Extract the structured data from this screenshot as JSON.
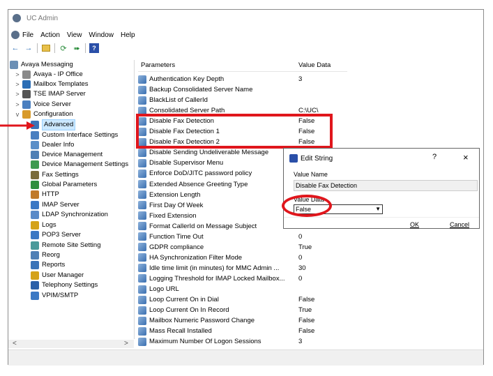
{
  "app": {
    "title": "UC Admin"
  },
  "menu": [
    "File",
    "Action",
    "View",
    "Window",
    "Help"
  ],
  "toolbar": [
    "back-arrow-icon",
    "forward-arrow-icon",
    "up-folder-icon",
    "refresh-icon",
    "export-icon",
    "help-icon"
  ],
  "tree": {
    "items": [
      {
        "label": "Avaya Messaging",
        "level": 0,
        "expander": "",
        "icon": "avaya-messaging-icon",
        "color": "#6b8fb5"
      },
      {
        "label": "Avaya - IP Office",
        "level": 1,
        "expander": ">",
        "icon": "person-icon",
        "color": "#8a8a8a"
      },
      {
        "label": "Mailbox Templates",
        "level": 1,
        "expander": ">",
        "icon": "template-icon",
        "color": "#2a6db5"
      },
      {
        "label": "TSE IMAP Server",
        "level": 1,
        "expander": ">",
        "icon": "server-icon",
        "color": "#555555"
      },
      {
        "label": "Voice Server",
        "level": 1,
        "expander": ">",
        "icon": "voice-server-icon",
        "color": "#4a7fc0"
      },
      {
        "label": "Configuration",
        "level": 1,
        "expander": "v",
        "icon": "configuration-icon",
        "color": "#d89a2a"
      },
      {
        "label": "Advanced",
        "level": 2,
        "expander": "",
        "icon": "advanced-icon",
        "color": "#3a73b8",
        "selected": true
      },
      {
        "label": "Custom Interface Settings",
        "level": 2,
        "expander": "",
        "icon": "custom-interface-icon",
        "color": "#4a7fc0"
      },
      {
        "label": "Dealer Info",
        "level": 2,
        "expander": "",
        "icon": "dealer-info-icon",
        "color": "#5b8fc8"
      },
      {
        "label": "Device Management",
        "level": 2,
        "expander": "",
        "icon": "device-management-icon",
        "color": "#4f7fb5"
      },
      {
        "label": "Device Management Settings",
        "level": 2,
        "expander": "",
        "icon": "device-settings-icon",
        "color": "#3e9a4f"
      },
      {
        "label": "Fax Settings",
        "level": 2,
        "expander": "",
        "icon": "fax-icon",
        "color": "#7a6b3a"
      },
      {
        "label": "Global Parameters",
        "level": 2,
        "expander": "",
        "icon": "globe-icon",
        "color": "#2f8f3f"
      },
      {
        "label": "HTTP",
        "level": 2,
        "expander": "",
        "icon": "http-icon",
        "color": "#c07a2a"
      },
      {
        "label": "IMAP Server",
        "level": 2,
        "expander": "",
        "icon": "imap-icon",
        "color": "#3b78c4"
      },
      {
        "label": "LDAP Synchronization",
        "level": 2,
        "expander": "",
        "icon": "ldap-icon",
        "color": "#5a8ac8"
      },
      {
        "label": "Logs",
        "level": 2,
        "expander": "",
        "icon": "logs-icon",
        "color": "#d4a21a"
      },
      {
        "label": "POP3 Server",
        "level": 2,
        "expander": "",
        "icon": "pop3-icon",
        "color": "#3b78c4"
      },
      {
        "label": "Remote Site Setting",
        "level": 2,
        "expander": "",
        "icon": "remote-site-icon",
        "color": "#4a9a9a"
      },
      {
        "label": "Reorg",
        "level": 2,
        "expander": "",
        "icon": "reorg-icon",
        "color": "#4f7fb5"
      },
      {
        "label": "Reports",
        "level": 2,
        "expander": "",
        "icon": "reports-icon",
        "color": "#3a73b8"
      },
      {
        "label": "User Manager",
        "level": 2,
        "expander": "",
        "icon": "user-manager-icon",
        "color": "#d4a21a"
      },
      {
        "label": "Telephony Settings",
        "level": 2,
        "expander": "",
        "icon": "telephony-icon",
        "color": "#2a5fa8"
      },
      {
        "label": "VPIM/SMTP",
        "level": 2,
        "expander": "",
        "icon": "vpim-icon",
        "color": "#3b78c4"
      }
    ]
  },
  "scroll": {
    "left": "<",
    "right": ">"
  },
  "list": {
    "headers": [
      "Parameters",
      "Value Data"
    ],
    "rows": [
      {
        "name": "Authentication Key Depth",
        "value": "3"
      },
      {
        "name": "Backup Consolidated Server Name",
        "value": ""
      },
      {
        "name": "BlackList of CallerId",
        "value": ""
      },
      {
        "name": "Consolidated Server Path",
        "value": "C:\\UC\\"
      },
      {
        "name": "Disable Fax Detection",
        "value": "False"
      },
      {
        "name": "Disable Fax Detection 1",
        "value": "False"
      },
      {
        "name": "Disable Fax Detection 2",
        "value": "False"
      },
      {
        "name": "Disable Sending Undeliverable Message",
        "value": ""
      },
      {
        "name": "Disable Supervisor Menu",
        "value": ""
      },
      {
        "name": "Enforce DoD/JITC password policy",
        "value": ""
      },
      {
        "name": "Extended Absence Greeting Type",
        "value": ""
      },
      {
        "name": "Extension Length",
        "value": ""
      },
      {
        "name": "First Day Of Week",
        "value": ""
      },
      {
        "name": "Fixed Extension",
        "value": ""
      },
      {
        "name": "Format CallerId on Message Subject",
        "value": ""
      },
      {
        "name": "Function Time Out",
        "value": "0"
      },
      {
        "name": "GDPR compliance",
        "value": "True"
      },
      {
        "name": "HA Synchronization Filter Mode",
        "value": "0"
      },
      {
        "name": "Idle time limit (in minutes) for MMC Admin ...",
        "value": "30"
      },
      {
        "name": "Logging Threshold for IMAP Locked Mailbox...",
        "value": "0"
      },
      {
        "name": "Logo URL",
        "value": ""
      },
      {
        "name": "Loop Current On in Dial",
        "value": "False"
      },
      {
        "name": "Loop Current On In Record",
        "value": "True"
      },
      {
        "name": "Mailbox Numeric Password Change",
        "value": "False"
      },
      {
        "name": "Mass Recall Installed",
        "value": "False"
      },
      {
        "name": "Maximum Number Of Logon Sessions",
        "value": "3"
      }
    ]
  },
  "dialog": {
    "title": "Edit String",
    "help": "?",
    "close": "×",
    "value_name_label": "Value Name",
    "value_name": "Disable Fax Detection",
    "value_data_label": "Value Data",
    "value_data": "False",
    "ok": "OK",
    "cancel": "Cancel"
  },
  "colors": {
    "highlight_red": "#e0161c",
    "selection_blue": "#cce8ff"
  }
}
